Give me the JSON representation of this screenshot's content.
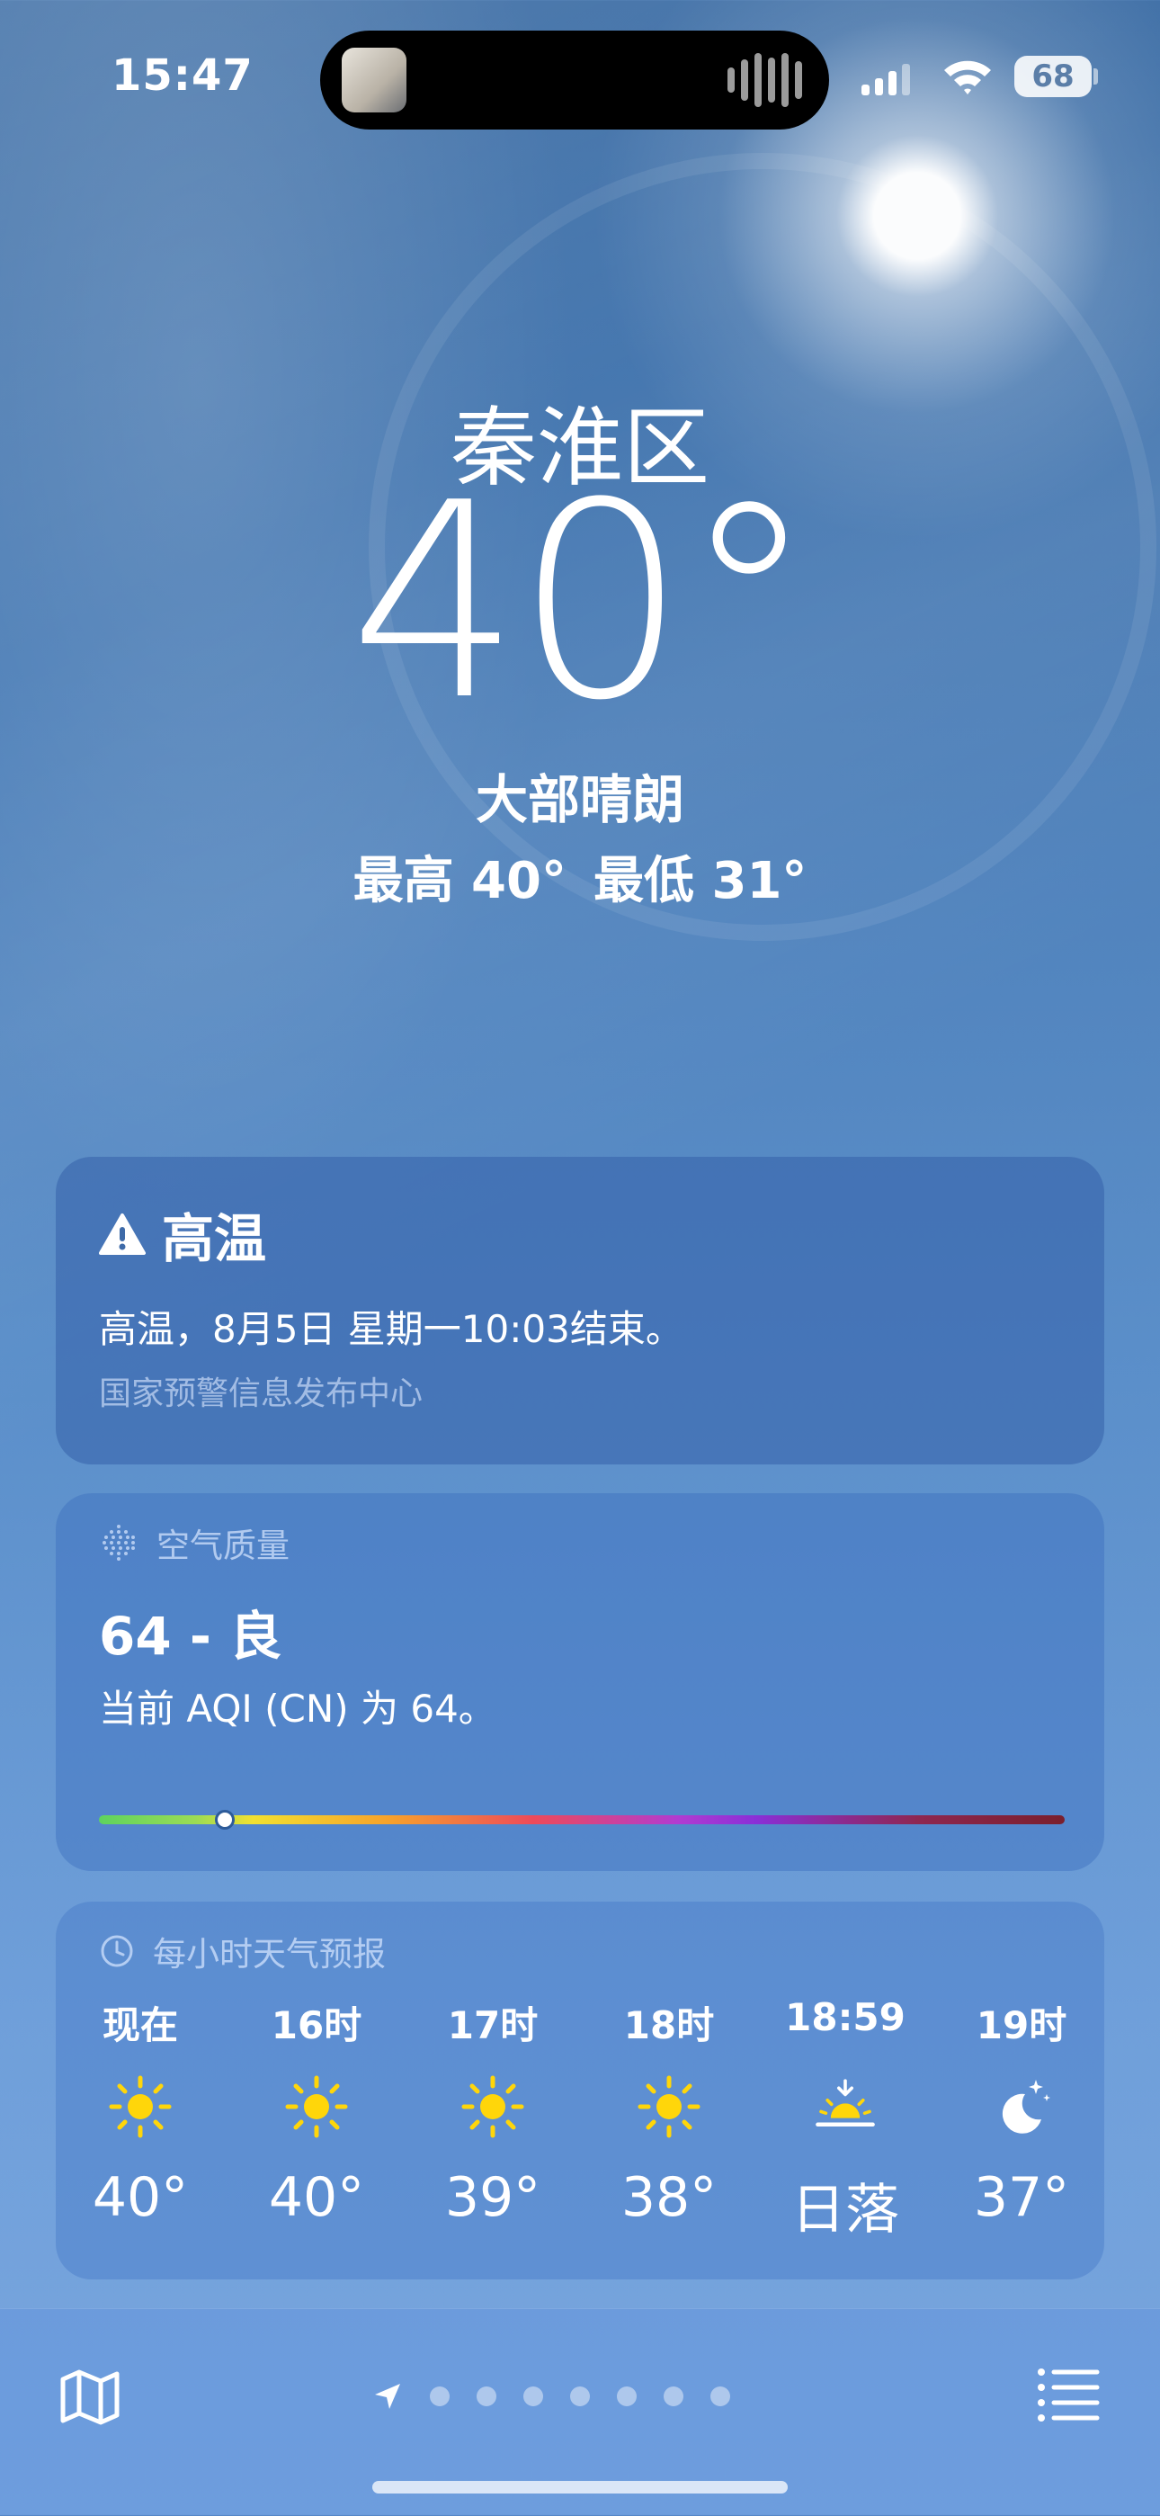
{
  "status_bar": {
    "time": "15:47",
    "battery": "68"
  },
  "location": {
    "city": "秦淮区",
    "temperature": "40°",
    "condition": "大部晴朗",
    "high": "最高 40°",
    "low": "最低 31°"
  },
  "alert": {
    "title": "高温",
    "body": "高温，8月5日 星期一10:03结束。",
    "source": "国家预警信息发布中心"
  },
  "air_quality": {
    "header": "空气质量",
    "value": "64 - 良",
    "description": "当前 AQI (CN) 为 64。",
    "level_fraction": 0.13
  },
  "hourly": {
    "header": "每小时天气预报",
    "items": [
      {
        "time": "现在",
        "icon": "sun-icon",
        "temp": "40°"
      },
      {
        "time": "16时",
        "icon": "sun-icon",
        "temp": "40°"
      },
      {
        "time": "17时",
        "icon": "sun-icon",
        "temp": "39°"
      },
      {
        "time": "18时",
        "icon": "sun-icon",
        "temp": "38°"
      },
      {
        "time": "18:59",
        "icon": "sunset-icon",
        "temp": "日落"
      },
      {
        "time": "19时",
        "icon": "moon-stars-icon",
        "temp": "37°"
      }
    ]
  },
  "toolbar": {
    "page_count": 8,
    "current_page": 0
  },
  "colors": {
    "sun": "#ffd60a",
    "aqi_gradient_start": "#5ed35e",
    "aqi_gradient_end": "#7a1f2d"
  }
}
